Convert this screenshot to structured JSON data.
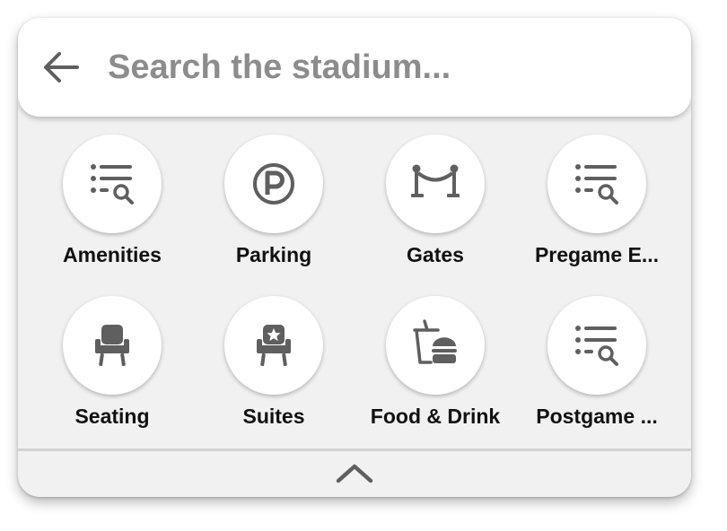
{
  "search": {
    "placeholder": "Search the stadium..."
  },
  "colors": {
    "icon": "#5f5f5f",
    "panel_bg": "#f1f1f1",
    "text": "#111111",
    "placeholder": "#8c8c8c"
  },
  "categories": [
    {
      "label": "Amenities",
      "icon": "list-search-icon"
    },
    {
      "label": "Parking",
      "icon": "parking-icon"
    },
    {
      "label": "Gates",
      "icon": "gate-rope-icon"
    },
    {
      "label": "Pregame E...",
      "icon": "list-search-icon"
    },
    {
      "label": "Seating",
      "icon": "seat-icon"
    },
    {
      "label": "Suites",
      "icon": "suite-seat-star-icon"
    },
    {
      "label": "Food & Drink",
      "icon": "food-drink-icon"
    },
    {
      "label": "Postgame ...",
      "icon": "list-search-icon"
    }
  ],
  "footer": {
    "collapse_icon": "chevron-up-icon"
  }
}
